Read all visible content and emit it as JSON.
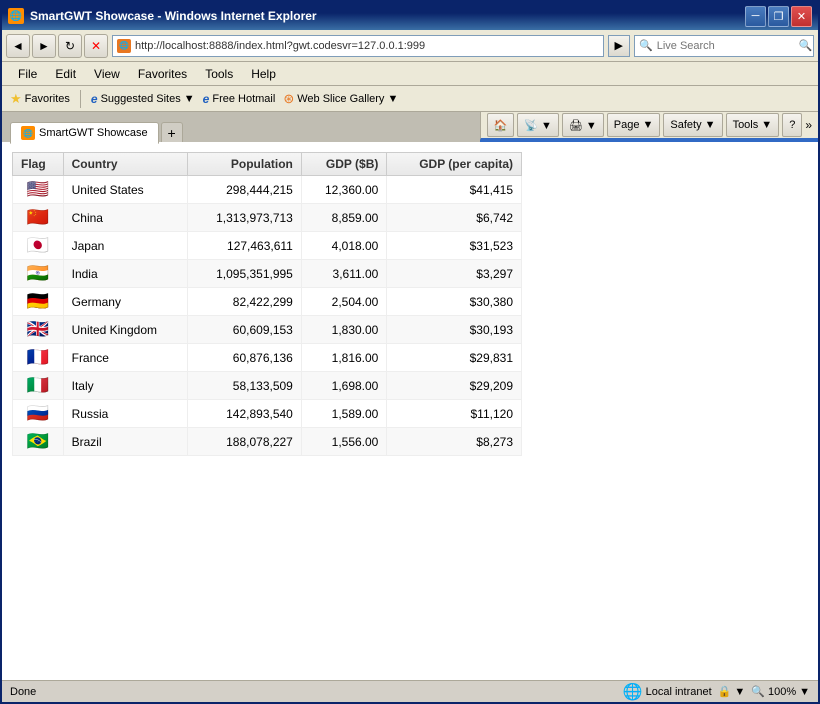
{
  "window": {
    "title": "SmartGWT Showcase - Windows Internet Explorer",
    "icon": "🌐"
  },
  "titlebar": {
    "minimize": "─",
    "restore": "❐",
    "close": "✕"
  },
  "navbar": {
    "back": "◄",
    "forward": "►",
    "refresh": "↻",
    "stop": "✕",
    "url": "http://localhost:8888/index.html?gwt.codesvr=127.0.0.1:999",
    "search_placeholder": "Live Search",
    "search_label": "Search"
  },
  "menubar": {
    "items": [
      "File",
      "Edit",
      "View",
      "Favorites",
      "Tools",
      "Help"
    ]
  },
  "favoritesbar": {
    "favorites_label": "Favorites",
    "items": [
      {
        "label": "Suggested Sites ▼",
        "icon": "ie"
      },
      {
        "label": "Free Hotmail",
        "icon": "ie"
      },
      {
        "label": "Web Slice Gallery ▼",
        "icon": "ie"
      }
    ]
  },
  "tab": {
    "label": "SmartGWT Showcase",
    "favicon": "🌐"
  },
  "toolbar": {
    "home": "🏠",
    "rss": "📡",
    "print": "🖨",
    "page": "Page ▼",
    "safety": "Safety ▼",
    "tools": "Tools ▼",
    "help": "?"
  },
  "grid": {
    "columns": [
      "Flag",
      "Country",
      "Population",
      "GDP ($B)",
      "GDP (per capita)"
    ],
    "rows": [
      {
        "flag": "🇺🇸",
        "country": "United States",
        "population": "298,444,215",
        "gdp": "12,360.00",
        "gdp_per_capita": "$41,415"
      },
      {
        "flag": "🇨🇳",
        "country": "China",
        "population": "1,313,973,713",
        "gdp": "8,859.00",
        "gdp_per_capita": "$6,742"
      },
      {
        "flag": "🇯🇵",
        "country": "Japan",
        "population": "127,463,611",
        "gdp": "4,018.00",
        "gdp_per_capita": "$31,523"
      },
      {
        "flag": "🇮🇳",
        "country": "India",
        "population": "1,095,351,995",
        "gdp": "3,611.00",
        "gdp_per_capita": "$3,297"
      },
      {
        "flag": "🇩🇪",
        "country": "Germany",
        "population": "82,422,299",
        "gdp": "2,504.00",
        "gdp_per_capita": "$30,380"
      },
      {
        "flag": "🇬🇧",
        "country": "United Kingdom",
        "population": "60,609,153",
        "gdp": "1,830.00",
        "gdp_per_capita": "$30,193"
      },
      {
        "flag": "🇫🇷",
        "country": "France",
        "population": "60,876,136",
        "gdp": "1,816.00",
        "gdp_per_capita": "$29,831"
      },
      {
        "flag": "🇮🇹",
        "country": "Italy",
        "population": "58,133,509",
        "gdp": "1,698.00",
        "gdp_per_capita": "$29,209"
      },
      {
        "flag": "🇷🇺",
        "country": "Russia",
        "population": "142,893,540",
        "gdp": "1,589.00",
        "gdp_per_capita": "$11,120"
      },
      {
        "flag": "🇧🇷",
        "country": "Brazil",
        "population": "188,078,227",
        "gdp": "1,556.00",
        "gdp_per_capita": "$8,273"
      }
    ]
  },
  "statusbar": {
    "status": "Done",
    "zone": "Local intranet",
    "zoom": "100%"
  }
}
